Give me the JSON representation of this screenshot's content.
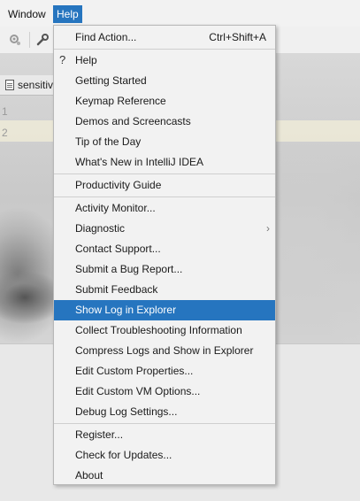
{
  "menubar": {
    "items": [
      {
        "label": "Window"
      },
      {
        "label": "Help"
      }
    ]
  },
  "editor": {
    "tab_label": "sensitiv",
    "line_numbers": [
      "1",
      "2"
    ]
  },
  "help_menu": {
    "find_action": {
      "label": "Find Action...",
      "shortcut": "Ctrl+Shift+A"
    },
    "items": [
      {
        "label": "Help"
      },
      {
        "label": "Getting Started"
      },
      {
        "label": "Keymap Reference"
      },
      {
        "label": "Demos and Screencasts"
      },
      {
        "label": "Tip of the Day"
      },
      {
        "label": "What's New in IntelliJ IDEA"
      },
      {
        "label": "Productivity Guide"
      },
      {
        "label": "Activity Monitor..."
      },
      {
        "label": "Diagnostic"
      },
      {
        "label": "Contact Support..."
      },
      {
        "label": "Submit a Bug Report..."
      },
      {
        "label": "Submit Feedback"
      },
      {
        "label": "Show Log in Explorer"
      },
      {
        "label": "Collect Troubleshooting Information"
      },
      {
        "label": "Compress Logs and Show in Explorer"
      },
      {
        "label": "Edit Custom Properties..."
      },
      {
        "label": "Edit Custom VM Options..."
      },
      {
        "label": "Debug Log Settings..."
      },
      {
        "label": "Register..."
      },
      {
        "label": "Check for Updates..."
      },
      {
        "label": "About"
      }
    ],
    "selected_item": "Show Log in Explorer",
    "submenu_indicator": "›",
    "help_icon_glyph": "?"
  },
  "colors": {
    "selection": "#2675bf",
    "menu_bg": "#f2f2f2"
  }
}
